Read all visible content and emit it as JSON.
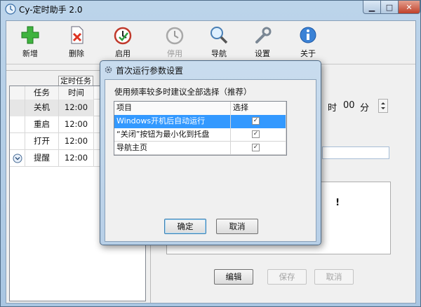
{
  "window": {
    "title": "Cy-定时助手 2.0",
    "controls": {
      "minimize": "▁",
      "maximize": "□",
      "close": "✕"
    }
  },
  "toolbar": [
    {
      "label": "新增",
      "icon": "plus-icon",
      "enabled": true
    },
    {
      "label": "删除",
      "icon": "delete-doc-icon",
      "enabled": true
    },
    {
      "label": "启用",
      "icon": "clock-enable-icon",
      "enabled": true
    },
    {
      "label": "停用",
      "icon": "clock-disable-icon",
      "enabled": false
    },
    {
      "label": "导航",
      "icon": "magnifier-icon",
      "enabled": true
    },
    {
      "label": "设置",
      "icon": "wrench-icon",
      "enabled": true
    },
    {
      "label": "关于",
      "icon": "info-icon",
      "enabled": true
    }
  ],
  "task_list": {
    "tab": "定时任务",
    "columns": [
      "任务",
      "时间"
    ],
    "rows": [
      {
        "task": "关机",
        "time": "12:00"
      },
      {
        "task": "重启",
        "time": "12:00"
      },
      {
        "task": "打开",
        "time": "12:00"
      },
      {
        "task": "提醒",
        "time": "12:00"
      }
    ]
  },
  "detail": {
    "hour_unit": "时",
    "minute": "00",
    "minute_unit": "分",
    "message_fragment": "!",
    "buttons": {
      "edit": "编辑",
      "save": "保存",
      "cancel": "取消"
    }
  },
  "dialog": {
    "title": "首次运行参数设置",
    "hint": "使用频率较多时建议全部选择（推荐）",
    "columns": {
      "item": "项目",
      "select": "选择"
    },
    "options": [
      {
        "label": "Windows开机后自动运行",
        "checked": true
      },
      {
        "label": "“关闭”按钮为最小化到托盘",
        "checked": true
      },
      {
        "label": "导航主页",
        "checked": true
      }
    ],
    "buttons": {
      "ok": "确定",
      "cancel": "取消"
    }
  }
}
